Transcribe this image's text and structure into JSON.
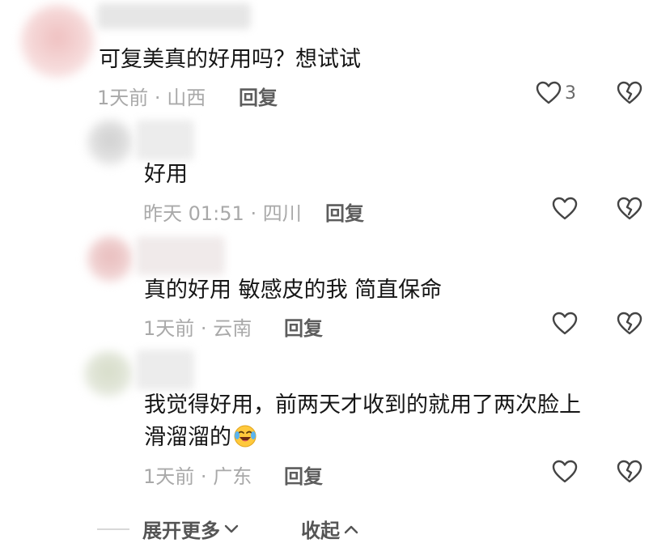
{
  "comments": [
    {
      "text": "可复美真的好用吗？想试试",
      "time": "1天前",
      "location": "山西",
      "reply_label": "回复",
      "like_count": "3",
      "avatar_color": "#f2c6c6"
    },
    {
      "text": "好用",
      "time": "昨天 01:51",
      "location": "四川",
      "reply_label": "回复",
      "like_count": "",
      "avatar_color": "#d8d8d8"
    },
    {
      "text": "真的好用 敏感皮的我 简直保命",
      "time": "1天前",
      "location": "云南",
      "reply_label": "回复",
      "like_count": "",
      "avatar_color": "#eccaca"
    },
    {
      "text_line1": "我觉得好用，前两天才收到的就用了两次脸上",
      "text_line2": "滑溜溜的",
      "emoji": "laughing-crying-emoji",
      "time": "1天前",
      "location": "广东",
      "reply_label": "回复",
      "like_count": "",
      "avatar_color": "#dfe4d6"
    }
  ],
  "meta_separator": "·",
  "footer": {
    "expand_label": "展开更多",
    "collapse_label": "收起"
  },
  "icons": {
    "like": "heart-outline-icon",
    "dislike": "broken-heart-icon",
    "expand": "chevron-down-icon",
    "collapse": "chevron-up-icon"
  },
  "colors": {
    "text": "#161616",
    "meta": "#a9a9a9",
    "reply": "#5d5d5d",
    "icon": "#444444"
  }
}
